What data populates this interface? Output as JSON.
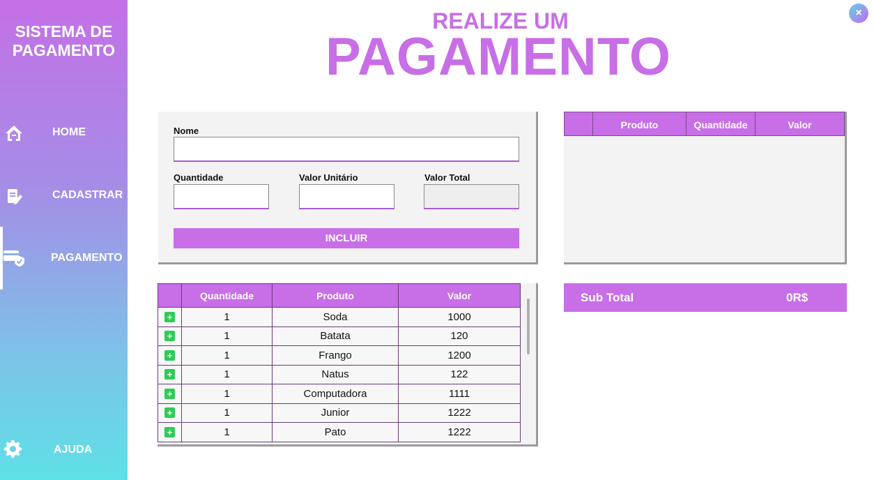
{
  "sidebar": {
    "brand_line1": "SISTEMA DE",
    "brand_line2": "PAGAMENTO",
    "items": [
      {
        "label": "HOME",
        "icon": "home-icon"
      },
      {
        "label": "CADASTRAR",
        "icon": "register-icon"
      },
      {
        "label": "PAGAMENTO",
        "icon": "payment-icon",
        "active": true
      },
      {
        "label": "AJUDA",
        "icon": "gear-icon"
      }
    ]
  },
  "header": {
    "title_top": "REALIZE UM",
    "title_main": "PAGAMENTO",
    "close": "×"
  },
  "form": {
    "nome_label": "Nome",
    "nome_value": "",
    "quantidade_label": "Quantidade",
    "quantidade_value": "",
    "valor_unitario_label": "Valor Unitário",
    "valor_unitario_value": "",
    "valor_total_label": "Valor Total",
    "valor_total_value": "",
    "include_label": "INCLUIR"
  },
  "cart": {
    "columns": [
      "",
      "Produto",
      "Quantidade",
      "Valor"
    ],
    "rows": []
  },
  "subtotal": {
    "label": "Sub Total",
    "value": "0R$"
  },
  "products": {
    "columns": [
      "",
      "Quantidade",
      "Produto",
      "Valor"
    ],
    "rows": [
      {
        "quantidade": "1",
        "produto": "Soda",
        "valor": "1000"
      },
      {
        "quantidade": "1",
        "produto": "Batata",
        "valor": "120"
      },
      {
        "quantidade": "1",
        "produto": "Frango",
        "valor": "1200"
      },
      {
        "quantidade": "1",
        "produto": "Natus",
        "valor": "122"
      },
      {
        "quantidade": "1",
        "produto": "Computadora",
        "valor": "1111"
      },
      {
        "quantidade": "1",
        "produto": "Junior",
        "valor": "1222"
      },
      {
        "quantidade": "1",
        "produto": "Pato",
        "valor": "1222"
      }
    ],
    "add_symbol": "+"
  },
  "colors": {
    "accent": "#c86ee6",
    "sidebar_top": "#c470e6",
    "sidebar_bottom": "#5ee0e6",
    "add_green": "#2ecc57"
  }
}
